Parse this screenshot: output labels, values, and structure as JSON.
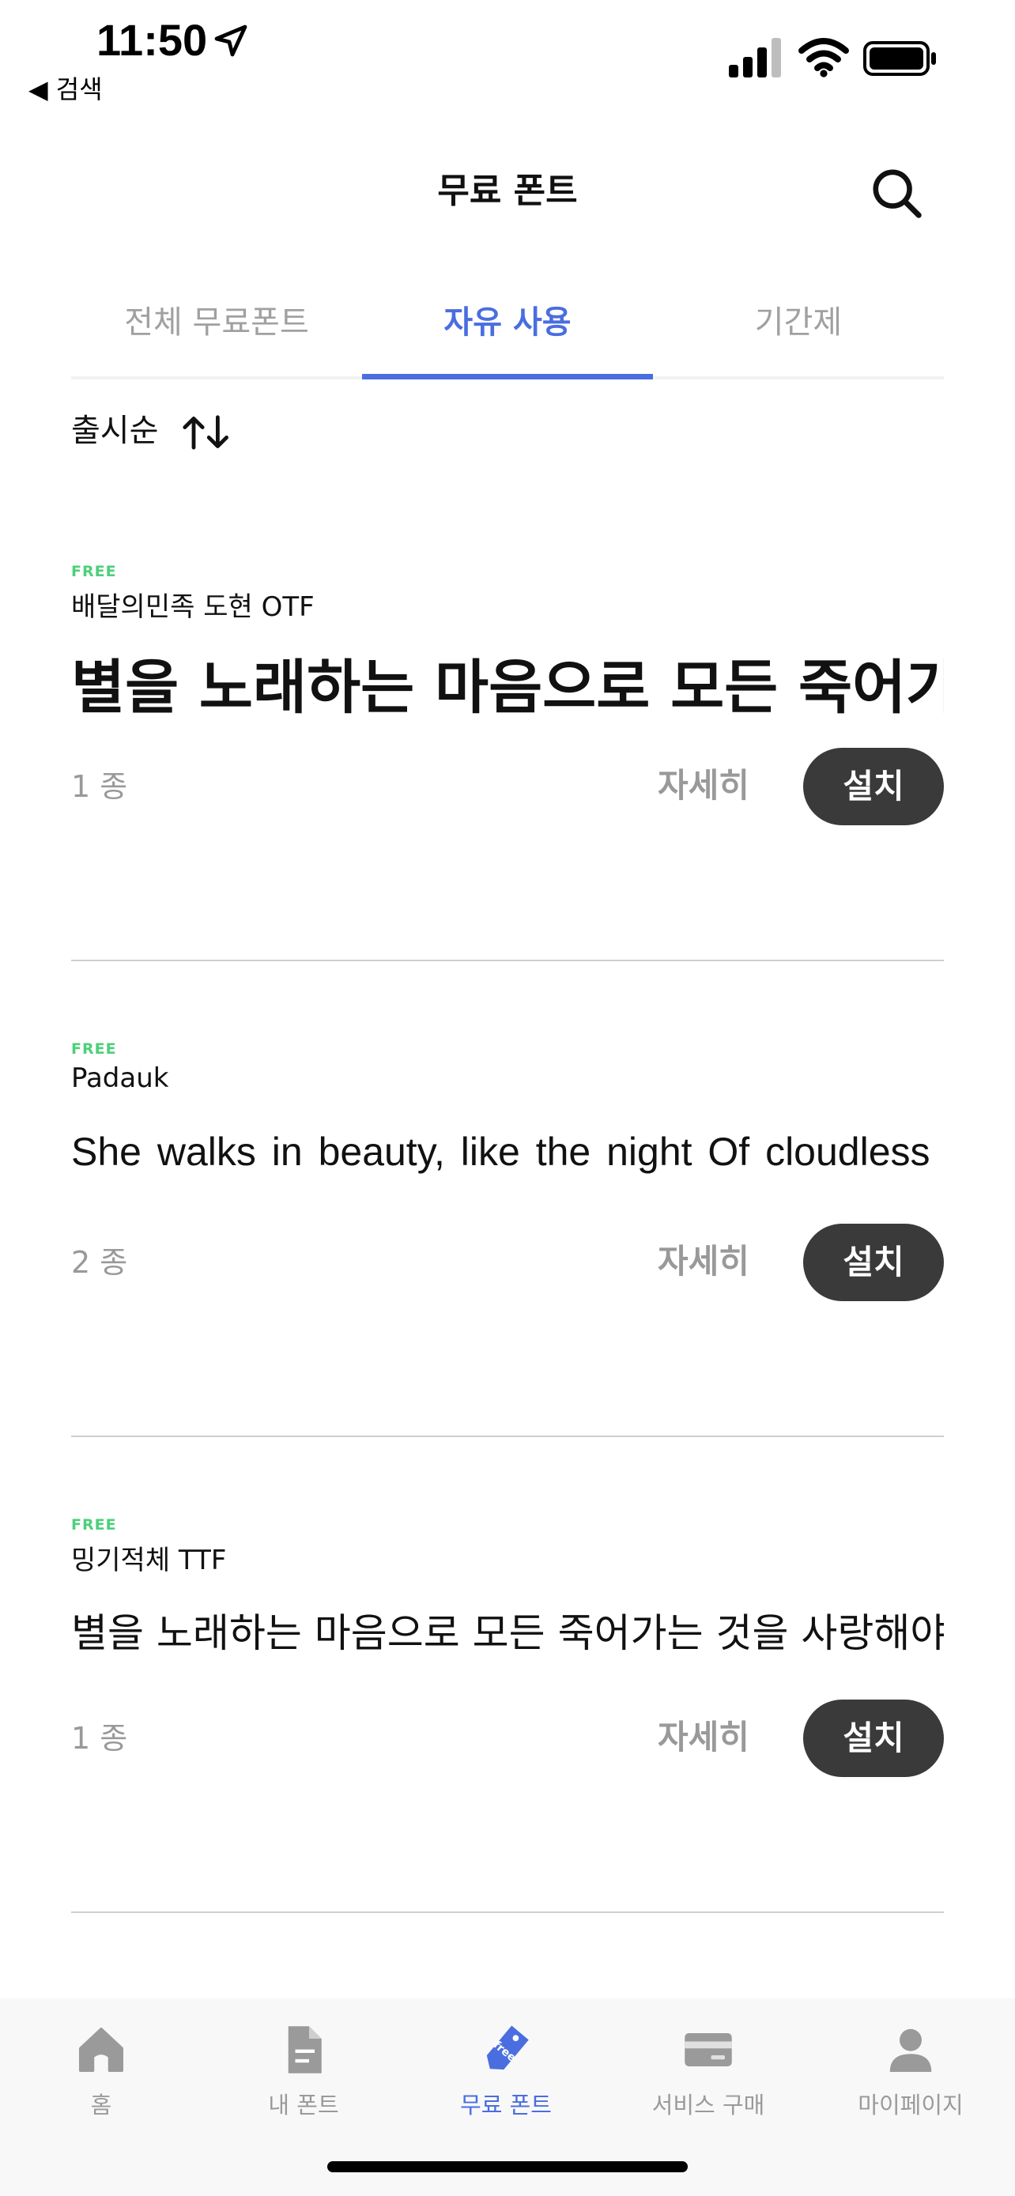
{
  "status_bar": {
    "time": "11:50",
    "back_label": "◀ 검색"
  },
  "header": {
    "title": "무료 폰트"
  },
  "tabs": [
    {
      "label": "전체 무료폰트",
      "active": false
    },
    {
      "label": "자유 사용",
      "active": true
    },
    {
      "label": "기간제",
      "active": false
    }
  ],
  "sort": {
    "label": "출시순"
  },
  "cards": [
    {
      "badge": "FREE",
      "name": "배달의민족 도현 OTF",
      "preview": "별을 노래하는 마음으로 모든 죽어가는 것을 사랑해야지",
      "count": "1 종",
      "detail_label": "자세히",
      "install_label": "설치"
    },
    {
      "badge": "FREE",
      "name": "Padauk",
      "preview": "She walks in beauty, like the night Of cloudless climes",
      "count": "2 종",
      "detail_label": "자세히",
      "install_label": "설치"
    },
    {
      "badge": "FREE",
      "name": "밍기적체 TTF",
      "preview": "별을 노래하는 마음으로 모든 죽어가는 것을 사랑해야지 그리고",
      "count": "1 종",
      "detail_label": "자세히",
      "install_label": "설치"
    }
  ],
  "nav": [
    {
      "label": "홈",
      "icon": "home-icon",
      "active": false
    },
    {
      "label": "내 폰트",
      "icon": "document-icon",
      "active": false
    },
    {
      "label": "무료 폰트",
      "icon": "free-tag-icon",
      "active": true
    },
    {
      "label": "서비스 구매",
      "icon": "card-icon",
      "active": false
    },
    {
      "label": "마이페이지",
      "icon": "person-icon",
      "active": false
    }
  ],
  "colors": {
    "accent": "#4a6ee0",
    "free_badge": "#4cd07a",
    "install_bg": "#3a3a3a"
  }
}
